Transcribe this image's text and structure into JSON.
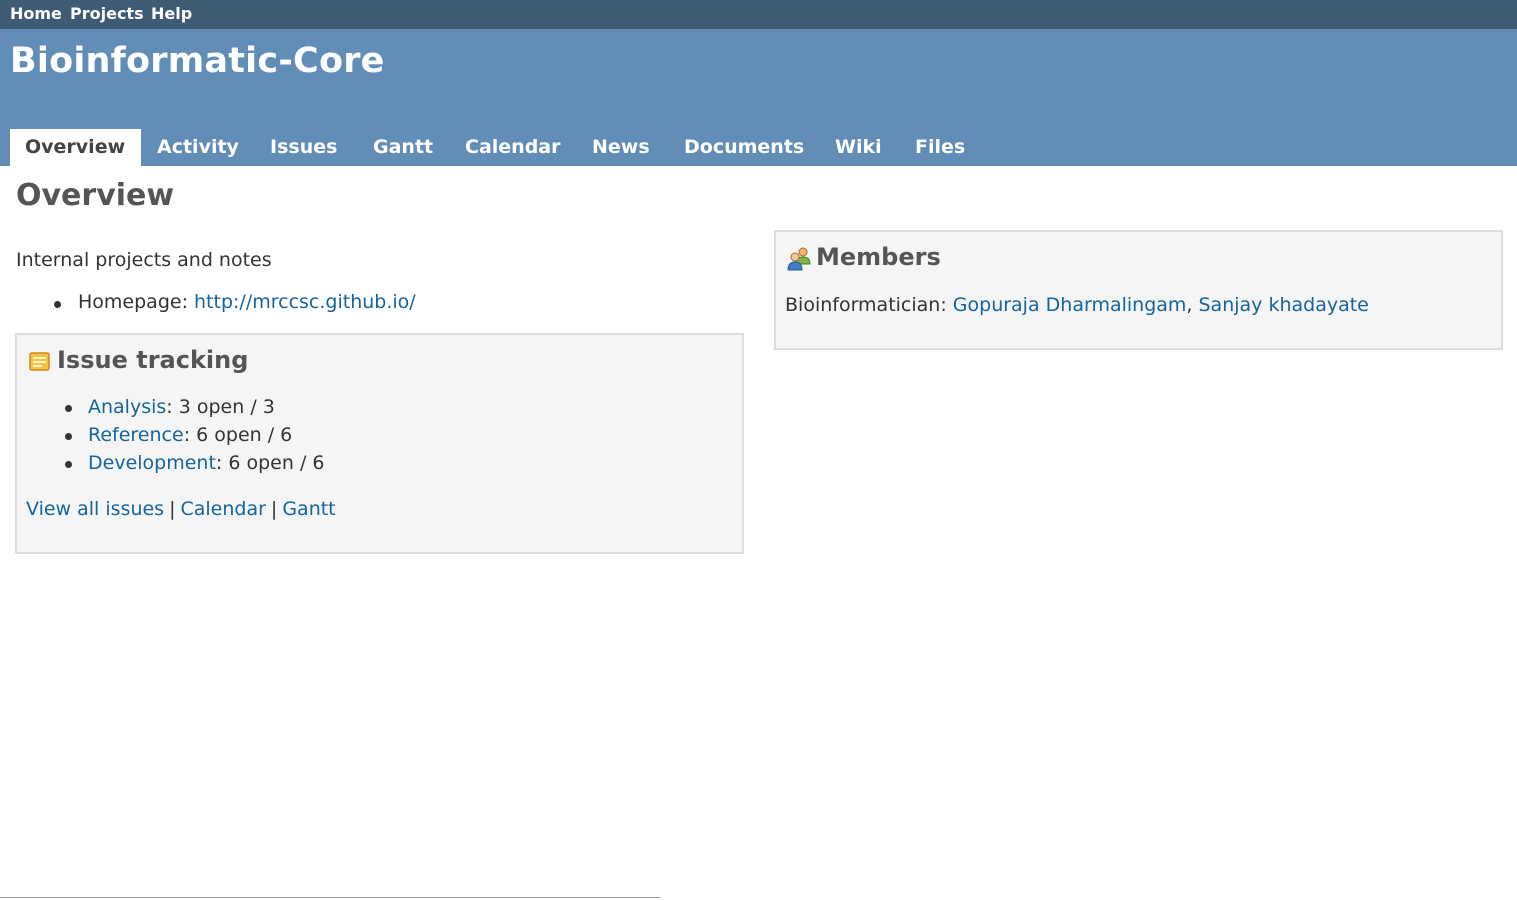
{
  "top_menu": {
    "items": [
      "Home",
      "Projects",
      "Help"
    ]
  },
  "header": {
    "project_title": "Bioinformatic-Core"
  },
  "tabs": [
    {
      "label": "Overview",
      "selected": true
    },
    {
      "label": "Activity"
    },
    {
      "label": "Issues"
    },
    {
      "label": "Gantt"
    },
    {
      "label": "Calendar"
    },
    {
      "label": "News"
    },
    {
      "label": "Documents"
    },
    {
      "label": "Wiki"
    },
    {
      "label": "Files"
    }
  ],
  "main": {
    "page_title": "Overview",
    "description": "Internal projects and notes",
    "homepage": {
      "label": "Homepage: ",
      "url": "http://mrccsc.github.io/"
    }
  },
  "issue_tracking": {
    "title": "Issue tracking",
    "trackers": [
      {
        "name": "Analysis",
        "count": ": 3 open / 3"
      },
      {
        "name": "Reference",
        "count": ": 6 open / 6"
      },
      {
        "name": "Development",
        "count": ": 6 open / 6"
      }
    ],
    "links": {
      "view_all": "View all issues",
      "calendar": "Calendar",
      "gantt": "Gantt"
    },
    "separator": "|"
  },
  "members": {
    "title": "Members",
    "role": "Bioinformatician: ",
    "people": [
      "Gopuraja Dharmalingam",
      "Sanjay khadayate"
    ],
    "separator": ", "
  },
  "colors": {
    "top_menu_bg": "#3e5b76",
    "header_bg": "#628db6",
    "link": "#15649e",
    "box_bg": "#f5f5f5",
    "box_border": "#dddddd"
  },
  "icons": {
    "issue_tracking": "ticket-icon",
    "members": "group-icon"
  }
}
